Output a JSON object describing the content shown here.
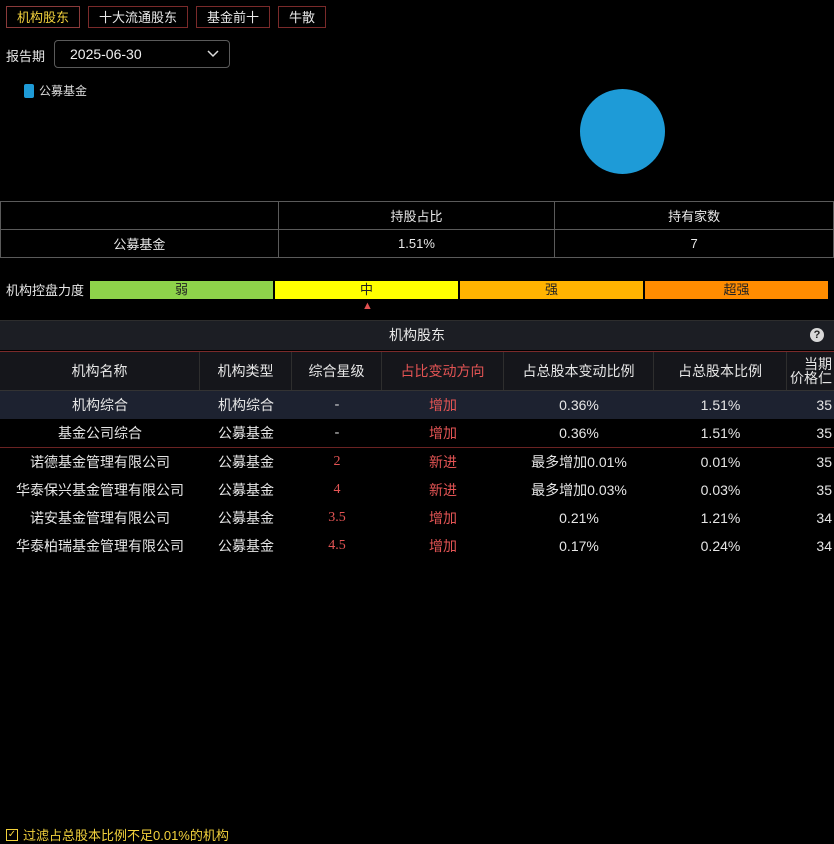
{
  "tabs": [
    {
      "label": "机构股东",
      "active": true
    },
    {
      "label": "十大流通股东",
      "active": false
    },
    {
      "label": "基金前十",
      "active": false
    },
    {
      "label": "牛散",
      "active": false
    }
  ],
  "report_period": {
    "label": "报告期",
    "value": "2025-06-30"
  },
  "colors": {
    "public_fund": "#1e9bd7",
    "weak": "#8ed34a",
    "medium": "#ffff00",
    "strong": "#ffb300",
    "super_strong": "#ff8c00"
  },
  "legend": [
    {
      "name": "公募基金",
      "color": "#1e9bd7",
      "icon": "legend-swatch"
    }
  ],
  "pie_chart": {
    "slices": [
      {
        "name": "公募基金",
        "value": 1.51
      }
    ]
  },
  "summary": {
    "headers": [
      "",
      "持股占比",
      "持有家数"
    ],
    "rows": [
      {
        "type": "公募基金",
        "ratio": "1.51%",
        "count": "7"
      }
    ]
  },
  "control": {
    "label": "机构控盘力度",
    "levels": [
      "弱",
      "中",
      "强",
      "超强"
    ],
    "current": "中",
    "marker_icon": "triangle-up-icon"
  },
  "section": {
    "title": "机构股东",
    "help_icon": "help-icon"
  },
  "holders": {
    "columns": [
      "机构名称",
      "机构类型",
      "综合星级",
      "占比变动方向",
      "占总股本变动比例",
      "占总股本比例",
      "当期",
      "价格仁"
    ],
    "rows": [
      {
        "name": "机构综合",
        "type": "机构综合",
        "rating": "-",
        "direction": "增加",
        "change": "0.36%",
        "ratio": "1.51%",
        "price": "35"
      },
      {
        "name": "基金公司综合",
        "type": "公募基金",
        "rating": "-",
        "direction": "增加",
        "change": "0.36%",
        "ratio": "1.51%",
        "price": "35"
      },
      {
        "name": "诺德基金管理有限公司",
        "type": "公募基金",
        "rating": "2",
        "direction": "新进",
        "change": "最多增加0.01%",
        "ratio": "0.01%",
        "price": "35"
      },
      {
        "name": "华泰保兴基金管理有限公司",
        "type": "公募基金",
        "rating": "4",
        "direction": "新进",
        "change": "最多增加0.03%",
        "ratio": "0.03%",
        "price": "35"
      },
      {
        "name": "诺安基金管理有限公司",
        "type": "公募基金",
        "rating": "3.5",
        "direction": "增加",
        "change": "0.21%",
        "ratio": "1.21%",
        "price": "34"
      },
      {
        "name": "华泰柏瑞基金管理有限公司",
        "type": "公募基金",
        "rating": "4.5",
        "direction": "增加",
        "change": "0.17%",
        "ratio": "0.24%",
        "price": "34"
      }
    ]
  },
  "filter": {
    "label": "过滤占总股本比例不足0.01%的机构",
    "checked": true
  }
}
